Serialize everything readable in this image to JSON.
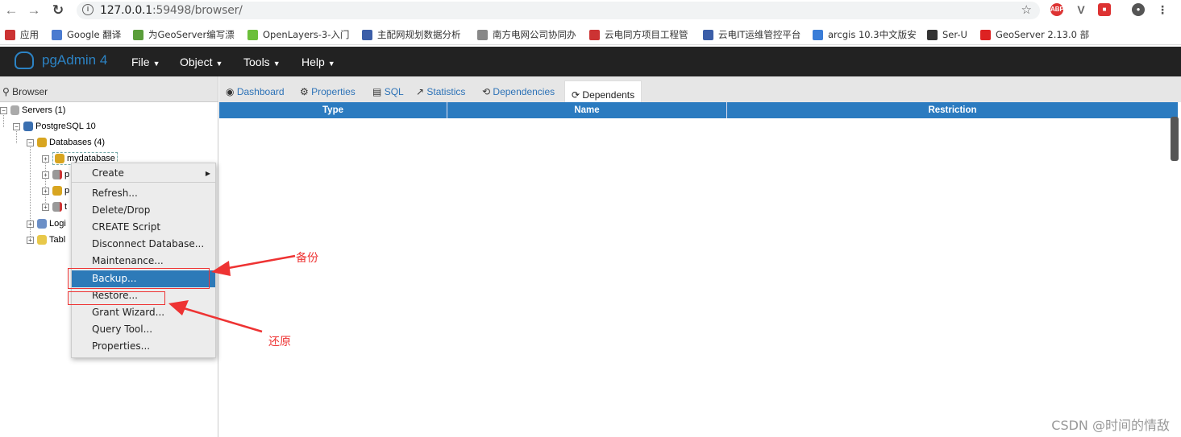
{
  "chrome": {
    "url_host": "127.0.0.1",
    "url_rest": ":59498/browser/",
    "bookmarks": [
      {
        "label": "应用",
        "icon": "apps-grid-icon",
        "color": "#c33"
      },
      {
        "label": "Google 翻译",
        "icon": "google-translate-icon",
        "color": "#4a7bd0"
      },
      {
        "label": "为GeoServer编写漂",
        "icon": "bookmark-icon",
        "color": "#5a9e3a"
      },
      {
        "label": "OpenLayers-3-入门",
        "icon": "openlayers-icon",
        "color": "#6bbf3a"
      },
      {
        "label": "主配网规划数据分析",
        "icon": "bookmark-icon",
        "color": "#3b5ea8"
      },
      {
        "label": "南方电网公司协同办",
        "icon": "page-icon",
        "color": "#888"
      },
      {
        "label": "云电同方项目工程管",
        "icon": "bookmark-icon",
        "color": "#c33"
      },
      {
        "label": "云电IT运维管控平台",
        "icon": "bookmark-icon",
        "color": "#3b5ea8"
      },
      {
        "label": "arcgis 10.3中文版安",
        "icon": "paw-icon",
        "color": "#3a7dd8"
      },
      {
        "label": "Ser-U",
        "icon": "serv-u-icon",
        "color": "#333"
      },
      {
        "label": "GeoServer 2.13.0 部",
        "icon": "csdn-c-icon",
        "color": "#d22"
      }
    ]
  },
  "app": {
    "brand": "pgAdmin 4",
    "menus": [
      "File",
      "Object",
      "Tools",
      "Help"
    ]
  },
  "browser": {
    "title": "Browser",
    "tree": [
      {
        "label": "Servers (1)"
      },
      {
        "label": "PostgreSQL 10"
      },
      {
        "label": "Databases (4)"
      },
      {
        "label": "mydatabase"
      },
      {
        "label": "p"
      },
      {
        "label": "p"
      },
      {
        "label": "t"
      },
      {
        "label": "Logi"
      },
      {
        "label": "Tabl"
      }
    ]
  },
  "context_menu": {
    "items": [
      "Create",
      "Refresh...",
      "Delete/Drop",
      "CREATE Script",
      "Disconnect Database...",
      "Maintenance...",
      "Backup...",
      "Restore...",
      "Grant Wizard...",
      "Query Tool...",
      "Properties..."
    ],
    "highlighted": "Backup..."
  },
  "tabs": [
    "Dashboard",
    "Properties",
    "SQL",
    "Statistics",
    "Dependencies",
    "Dependents"
  ],
  "active_tab": "Dependents",
  "grid": {
    "columns": [
      "Type",
      "Name",
      "Restriction"
    ]
  },
  "annotations": {
    "backup": "备份",
    "restore": "还原"
  },
  "watermark": "CSDN @时间的情敌",
  "colors": {
    "navbar": "#222222",
    "accent": "#2c83c4",
    "highlight": "#2d7ab8",
    "annotation": "#ee3333"
  }
}
